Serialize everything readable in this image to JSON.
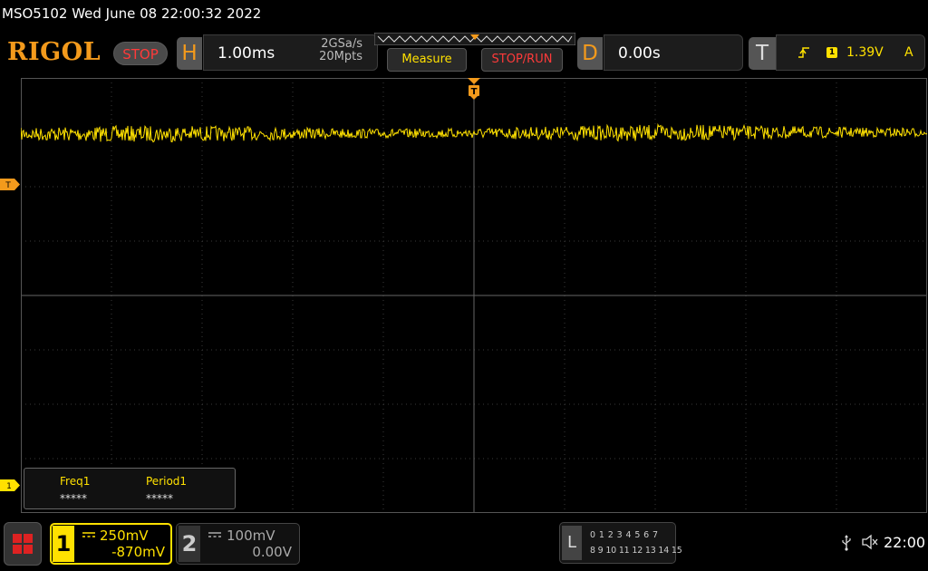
{
  "header": {
    "title": "MSO5102  Wed June 08 22:00:32 2022",
    "logo": "RIGOL",
    "run_state": "STOP"
  },
  "horizontal": {
    "letter": "H",
    "timebase": "1.00ms",
    "sample_rate": "2GSa/s",
    "memory_depth": "20Mpts"
  },
  "buttons": {
    "measure": "Measure",
    "stop_run": "STOP/RUN"
  },
  "delay": {
    "letter": "D",
    "value": "0.00s"
  },
  "trigger": {
    "letter": "T",
    "source": "1",
    "level": "1.39V",
    "mode": "A",
    "marker_label": "T"
  },
  "measurements": [
    {
      "name": "Freq1",
      "value": "*****"
    },
    {
      "name": "Period1",
      "value": "*****"
    }
  ],
  "channels": [
    {
      "number": "1",
      "scale": "250mV",
      "offset": "-870mV",
      "color": "#ffe100",
      "active": true
    },
    {
      "number": "2",
      "scale": "100mV",
      "offset": "0.00V",
      "color": "#aaaaaa",
      "active": false
    }
  ],
  "logic_analyzer": {
    "letter": "L",
    "row1": "0 1 2 3  4 5 6 7",
    "row2": "8 9 10 11 12 13 14 15"
  },
  "status": {
    "usb_icon": "usb-icon",
    "sound_icon": "speaker-muted-icon",
    "time": "22:00"
  },
  "colors": {
    "brand": "#f39a1c",
    "ch1": "#ffe100",
    "stop_red": "#ff3a3a",
    "grid": "#5a5a5a"
  }
}
